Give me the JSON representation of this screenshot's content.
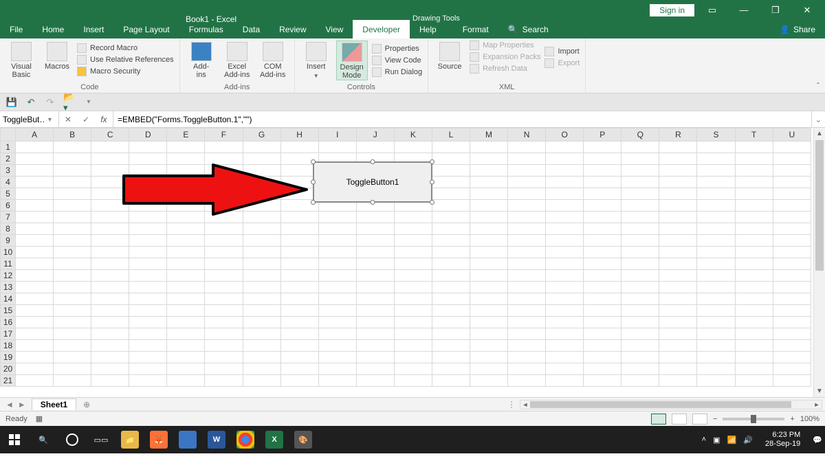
{
  "title": {
    "document": "Book1  -  Excel",
    "contextual": "Drawing Tools"
  },
  "window_controls": {
    "signin": "Sign in"
  },
  "tabs": {
    "file": "File",
    "home": "Home",
    "insert": "Insert",
    "pagelayout": "Page Layout",
    "formulas": "Formulas",
    "data": "Data",
    "review": "Review",
    "view": "View",
    "developer": "Developer",
    "help": "Help",
    "format": "Format",
    "search": "Search",
    "share": "Share"
  },
  "ribbon": {
    "code": {
      "label": "Code",
      "visual_basic": "Visual\nBasic",
      "macros": "Macros",
      "record": "Record Macro",
      "relative": "Use Relative References",
      "security": "Macro Security"
    },
    "addins": {
      "label": "Add-ins",
      "addins": "Add-\nins",
      "excel": "Excel\nAdd-ins",
      "com": "COM\nAdd-ins"
    },
    "controls": {
      "label": "Controls",
      "insert": "Insert",
      "design": "Design\nMode",
      "properties": "Properties",
      "viewcode": "View Code",
      "rundialog": "Run Dialog"
    },
    "xml": {
      "label": "XML",
      "source": "Source",
      "map_props": "Map Properties",
      "expansion": "Expansion Packs",
      "refresh": "Refresh Data",
      "import": "Import",
      "export": "Export"
    }
  },
  "namebox": "ToggleBut…",
  "formula": "=EMBED(\"Forms.ToggleButton.1\",\"\")",
  "columns": [
    "A",
    "B",
    "C",
    "D",
    "E",
    "F",
    "G",
    "H",
    "I",
    "J",
    "K",
    "L",
    "M",
    "N",
    "O",
    "P",
    "Q",
    "R",
    "S",
    "T",
    "U"
  ],
  "rows": 21,
  "object_label": "ToggleButton1",
  "sheet": {
    "active": "Sheet1"
  },
  "status": {
    "ready": "Ready",
    "zoom": "100%"
  },
  "taskbar": {
    "time": "6:23 PM",
    "date": "28-Sep-19"
  }
}
